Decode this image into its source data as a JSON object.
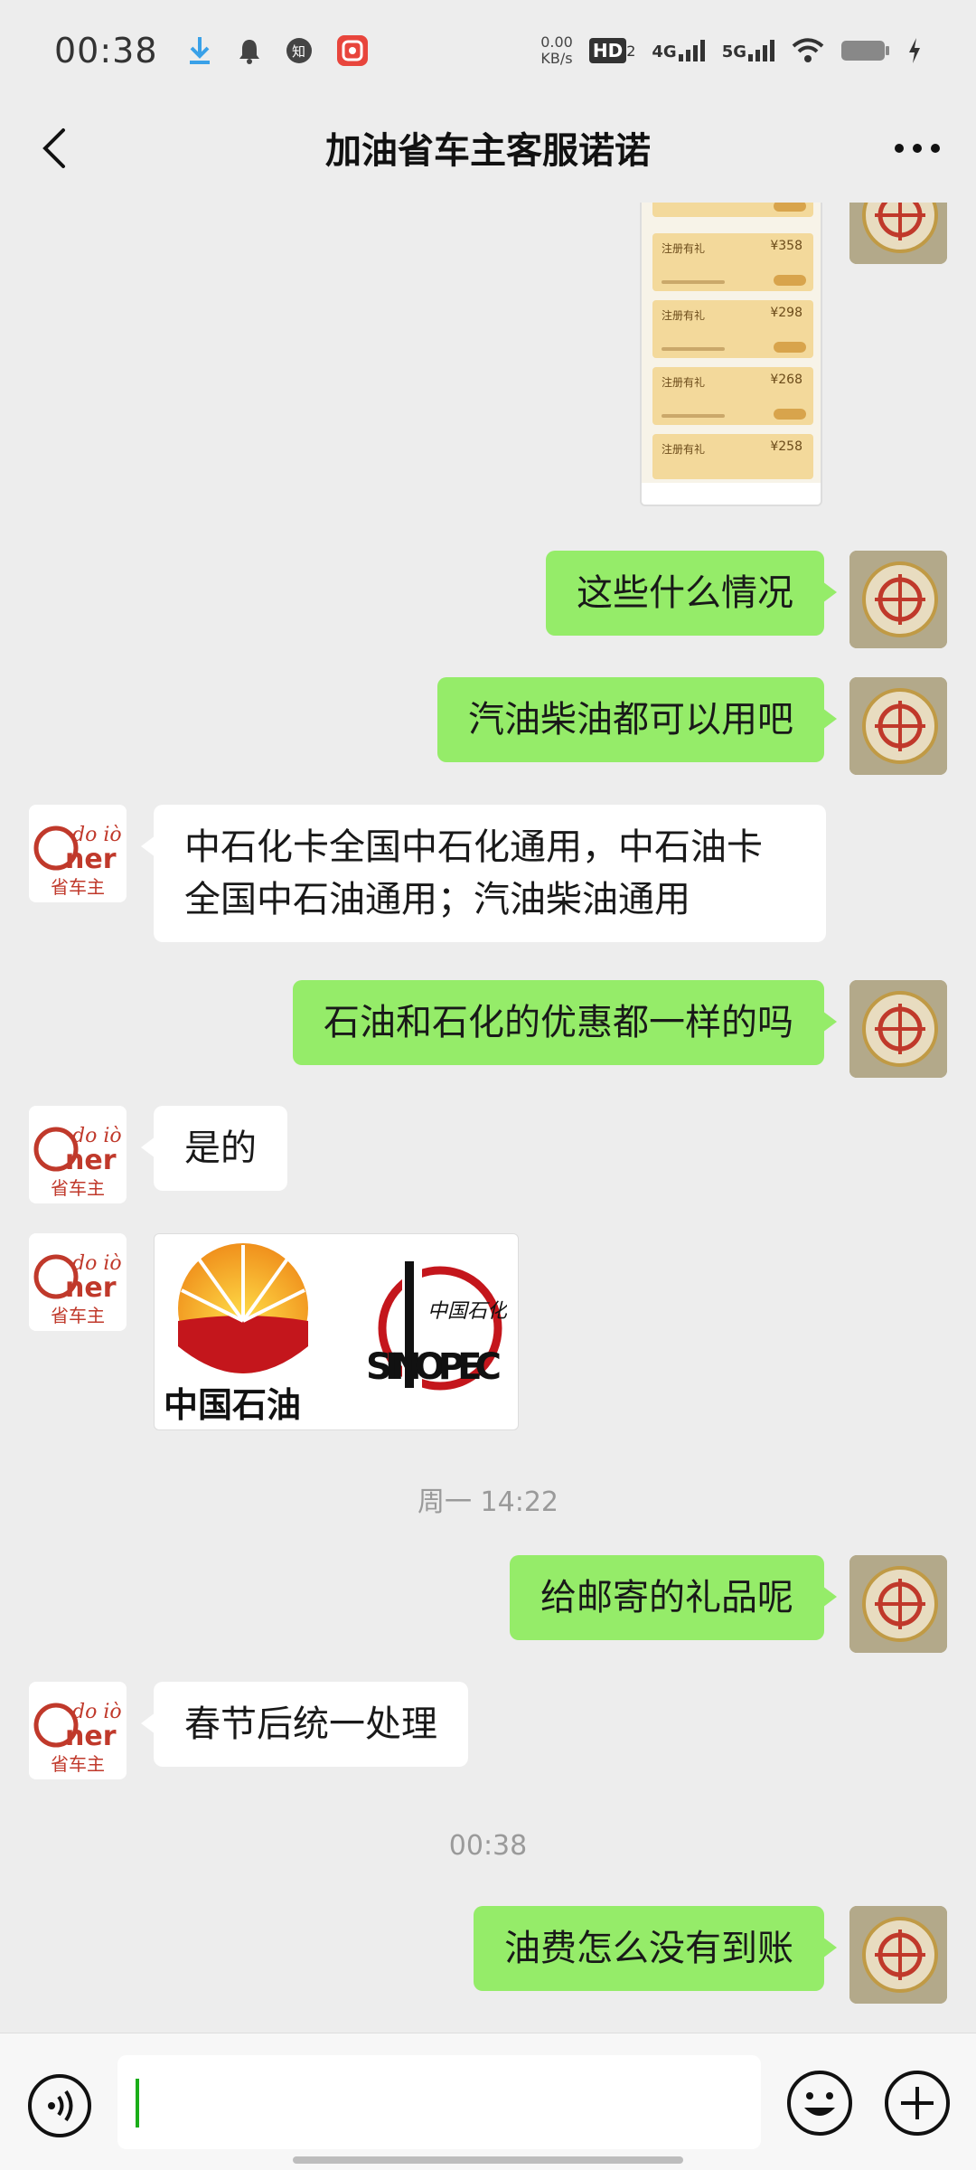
{
  "status_bar": {
    "time": "00:38",
    "net_speed_value": "0.00",
    "net_speed_unit": "KB/s",
    "hd_label": "HD",
    "hd_sub": "2",
    "net_4g": "4G",
    "net_5g": "5G",
    "app_badge": "知"
  },
  "header": {
    "title": "加油省车主客服诺诺"
  },
  "screenshot_card": {
    "rows": [
      {
        "name": "注册有礼",
        "price": "¥358"
      },
      {
        "name": "注册有礼",
        "price": "¥298"
      },
      {
        "name": "注册有礼",
        "price": "¥268"
      },
      {
        "name": "注册有礼",
        "price": "¥258"
      }
    ]
  },
  "messages": [
    {
      "side": "right",
      "text": "这些什么情况"
    },
    {
      "side": "right",
      "text": "汽油柴油都可以用吧"
    },
    {
      "side": "left",
      "text": "中石化卡全国中石化通用，中石油卡全国中石油通用；汽油柴油通用"
    },
    {
      "side": "right",
      "text": "石油和石化的优惠都一样的吗"
    },
    {
      "side": "left",
      "text": "是的"
    },
    {
      "side": "right",
      "text": "给邮寄的礼品呢"
    },
    {
      "side": "left",
      "text": "春节后统一处理"
    },
    {
      "side": "right",
      "text": "油费怎么没有到账"
    }
  ],
  "timestamps": [
    "周一 14:22",
    "00:38"
  ],
  "logo_card": {
    "cnpc_text": "中国石油",
    "sinopec_cn": "中国石化",
    "sinopec_en": "SINOPEC"
  },
  "cs_avatar": {
    "brand_top": "do iò",
    "brand_mid": "ner",
    "brand_bottom": "省车主"
  },
  "colors": {
    "accent_green": "#95ec69",
    "background": "#ededed",
    "caret": "#1aad19"
  }
}
